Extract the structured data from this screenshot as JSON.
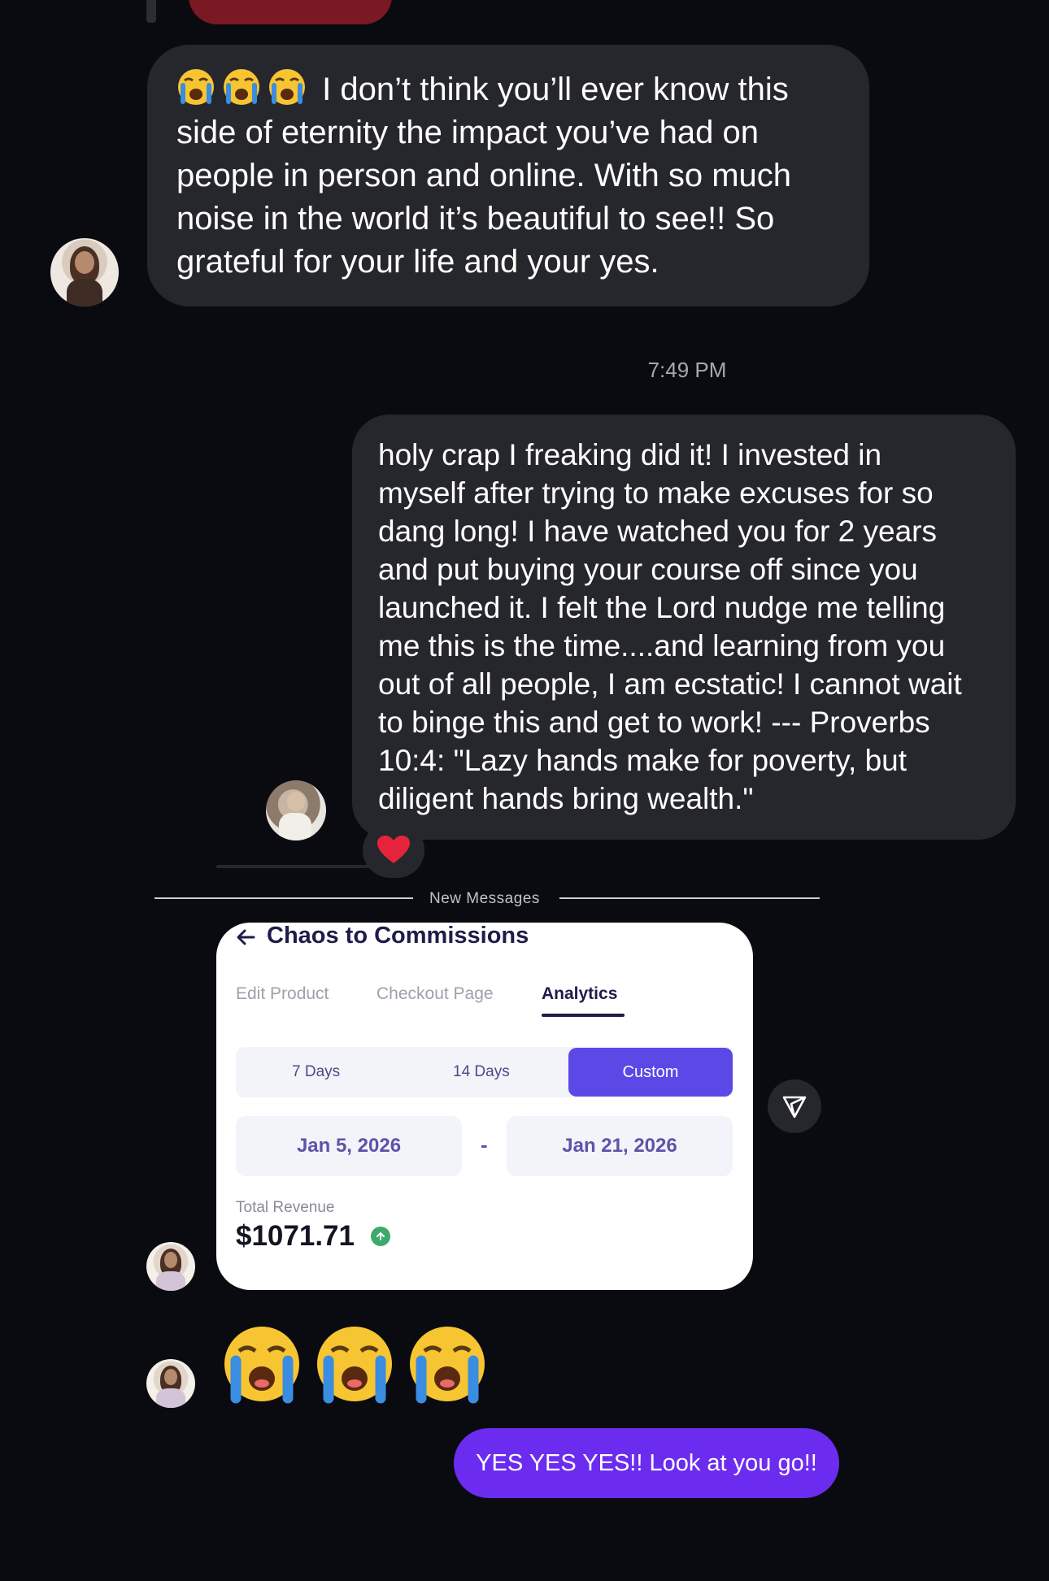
{
  "conversation": {
    "messages": [
      {
        "id": "msg1",
        "direction": "incoming",
        "emoji_prefix": [
          "crying-face",
          "crying-face",
          "crying-face"
        ],
        "lines": [
          "I don’t think you’ll ever know this",
          "side of eternity the impact you’ve had on",
          "people in person and online. With so much",
          "noise in the world it’s beautiful to see!! So",
          "grateful for your life and your yes."
        ]
      },
      {
        "id": "msg2",
        "direction": "incoming",
        "lines": [
          "holy crap I freaking did it! I invested in",
          "myself after trying to make excuses for so",
          "dang long! I  have watched you for 2 years",
          "and put buying your course off since you",
          "launched it. I felt the Lord nudge me telling",
          "me this is the time....and learning from you",
          "out of all people, I am ecstatic! I cannot wait",
          "to binge this and get to work! --- Proverbs",
          "10:4: \"Lazy hands make for poverty, but",
          "diligent hands bring wealth.\""
        ],
        "reaction": "❤️"
      },
      {
        "id": "msg4",
        "direction": "incoming",
        "emojis": [
          "crying-face",
          "crying-face",
          "crying-face"
        ]
      },
      {
        "id": "msg5",
        "direction": "outgoing",
        "text": "YES YES YES!! Look at you go!!",
        "color": "#6c2cf0"
      }
    ],
    "timestamp": "7:49 PM",
    "new_messages_label": "New Messages"
  },
  "shared_card": {
    "title": "Chaos to Commissions",
    "tabs": [
      {
        "label": "Edit Product",
        "active": false
      },
      {
        "label": "Checkout Page",
        "active": false
      },
      {
        "label": "Analytics",
        "active": true
      }
    ],
    "ranges": [
      {
        "label": "7 Days",
        "active": false
      },
      {
        "label": "14 Days",
        "active": false
      },
      {
        "label": "Custom",
        "active": true
      }
    ],
    "start_date": "Jan 5, 2026",
    "end_date": "Jan 21, 2026",
    "date_separator": "-",
    "revenue_label": "Total Revenue",
    "revenue_value": "$1071.71",
    "accent_color": "#5b48e6"
  },
  "icons": {
    "share": "paper-plane-icon",
    "back": "arrow-left-icon",
    "trend": "arrow-up-icon"
  }
}
